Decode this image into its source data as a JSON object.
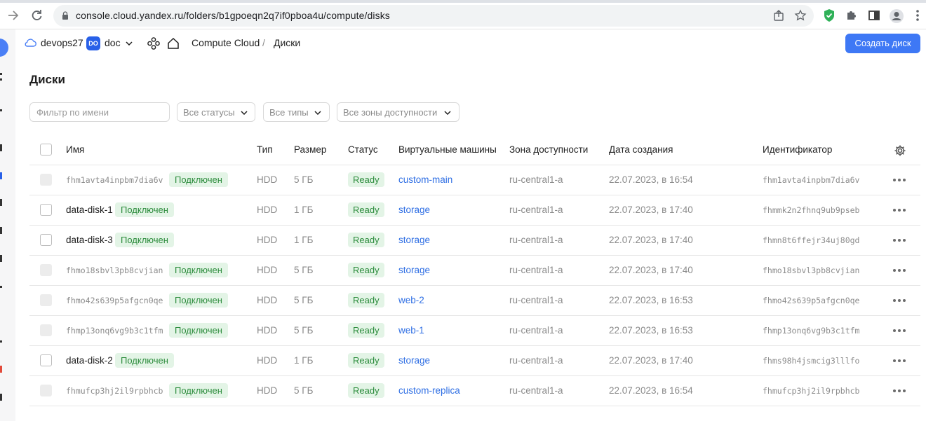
{
  "browser": {
    "url": "console.cloud.yandex.ru/folders/b1gpoeqn2q7if0pboa4u/compute/disks",
    "icons": [
      "forward-icon",
      "reload-icon",
      "lock-icon",
      "share-icon",
      "star-icon",
      "shield-extension-icon",
      "puzzle-icon",
      "sidepanel-icon",
      "profile-icon",
      "menu-icon"
    ]
  },
  "header": {
    "cloud_name": "devops27",
    "folder_badge": "DO",
    "folder_name": "doc",
    "service": "Compute Cloud",
    "separator": "/",
    "section": "Диски",
    "create_button": "Создать диск"
  },
  "page": {
    "title": "Диски",
    "filter_placeholder": "Фильтр по имени",
    "status_select": "Все статусы",
    "type_select": "Все типы",
    "zone_select": "Все зоны доступности"
  },
  "table": {
    "columns": [
      "Имя",
      "Тип",
      "Размер",
      "Статус",
      "Виртуальные машины",
      "Зона доступности",
      "Дата создания",
      "Идентификатор"
    ],
    "rows": [
      {
        "name": "fhm1avta4inpbm7dia6v",
        "name_is_id": true,
        "attached": "Подключен",
        "type": "HDD",
        "size": "5 ГБ",
        "status": "Ready",
        "vm": "custom-main",
        "zone": "ru-central1-a",
        "created": "22.07.2023, в 16:54",
        "id": "fhm1avta4inpbm7dia6v"
      },
      {
        "name": "data-disk-1",
        "name_is_id": false,
        "attached": "Подключен",
        "type": "HDD",
        "size": "1 ГБ",
        "status": "Ready",
        "vm": "storage",
        "zone": "ru-central1-a",
        "created": "22.07.2023, в 17:40",
        "id": "fhmmk2n2fhnq9ub9pseb"
      },
      {
        "name": "data-disk-3",
        "name_is_id": false,
        "attached": "Подключен",
        "type": "HDD",
        "size": "1 ГБ",
        "status": "Ready",
        "vm": "storage",
        "zone": "ru-central1-a",
        "created": "22.07.2023, в 17:40",
        "id": "fhmn8t6ffejr34uj80gd"
      },
      {
        "name": "fhmo18sbvl3pb8cvjian",
        "name_is_id": true,
        "attached": "Подключен",
        "type": "HDD",
        "size": "5 ГБ",
        "status": "Ready",
        "vm": "storage",
        "zone": "ru-central1-a",
        "created": "22.07.2023, в 17:40",
        "id": "fhmo18sbvl3pb8cvjian"
      },
      {
        "name": "fhmo42s639p5afgcn0qe",
        "name_is_id": true,
        "attached": "Подключен",
        "type": "HDD",
        "size": "5 ГБ",
        "status": "Ready",
        "vm": "web-2",
        "zone": "ru-central1-a",
        "created": "22.07.2023, в 16:53",
        "id": "fhmo42s639p5afgcn0qe"
      },
      {
        "name": "fhmp13onq6vg9b3c1tfm",
        "name_is_id": true,
        "attached": "Подключен",
        "type": "HDD",
        "size": "5 ГБ",
        "status": "Ready",
        "vm": "web-1",
        "zone": "ru-central1-a",
        "created": "22.07.2023, в 16:53",
        "id": "fhmp13onq6vg9b3c1tfm"
      },
      {
        "name": "data-disk-2",
        "name_is_id": false,
        "attached": "Подключен",
        "type": "HDD",
        "size": "1 ГБ",
        "status": "Ready",
        "vm": "storage",
        "zone": "ru-central1-a",
        "created": "22.07.2023, в 17:40",
        "id": "fhms98h4jsmcig3lllfo"
      },
      {
        "name": "fhmufcp3hj2il9rpbhcb",
        "name_is_id": true,
        "attached": "Подключен",
        "type": "HDD",
        "size": "5 ГБ",
        "status": "Ready",
        "vm": "custom-replica",
        "zone": "ru-central1-a",
        "created": "22.07.2023, в 16:54",
        "id": "fhmufcp3hj2il9rpbhcb"
      }
    ]
  },
  "colors": {
    "accent": "#3e78f5",
    "link": "#2f6fe4",
    "badge_bg": "#e3f4e6",
    "badge_text": "#2c8c3c"
  }
}
